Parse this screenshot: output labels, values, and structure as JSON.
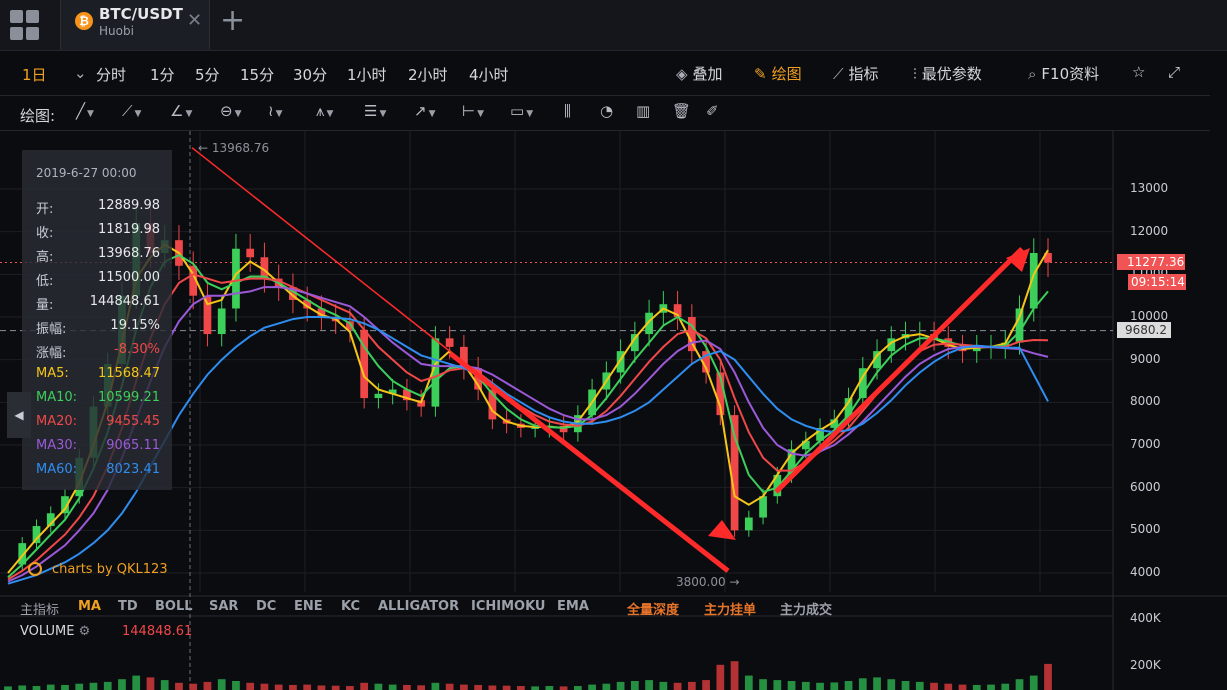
{
  "tab": {
    "title": "BTC/USDT",
    "exchange": "Huobi",
    "coin_glyph": "₿",
    "close_glyph": "✕",
    "add_glyph": "+"
  },
  "periods": [
    {
      "label": "1日",
      "active": true
    },
    {
      "label": "分时",
      "active": false
    },
    {
      "label": "1分",
      "active": false
    },
    {
      "label": "5分",
      "active": false
    },
    {
      "label": "15分",
      "active": false
    },
    {
      "label": "30分",
      "active": false
    },
    {
      "label": "1小时",
      "active": false
    },
    {
      "label": "2小时",
      "active": false
    },
    {
      "label": "4小时",
      "active": false
    }
  ],
  "toolbar_right": {
    "overlay": "叠加",
    "draw": "绘图",
    "indicator": "指标",
    "optimal": "最优参数",
    "f10": "F10资料"
  },
  "draw_bar": {
    "label": "绘图:"
  },
  "info_panel": {
    "date": "2019-6-27 00:00",
    "rows": [
      {
        "k": "开:",
        "v": "12889.98",
        "color": "#e6e8ec"
      },
      {
        "k": "收:",
        "v": "11819.98",
        "color": "#e6e8ec"
      },
      {
        "k": "高:",
        "v": "13968.76",
        "color": "#e6e8ec"
      },
      {
        "k": "低:",
        "v": "11500.00",
        "color": "#e6e8ec"
      },
      {
        "k": "量:",
        "v": "144848.61",
        "color": "#e6e8ec"
      },
      {
        "k": "振幅:",
        "v": "19.15%",
        "color": "#e6e8ec"
      },
      {
        "k": "涨幅:",
        "v": "-8.30%",
        "color": "#f04848"
      },
      {
        "k": "MA5:",
        "v": "11568.47",
        "color": "#f5c518"
      },
      {
        "k": "MA10:",
        "v": "10599.21",
        "color": "#3ccf5a"
      },
      {
        "k": "MA20:",
        "v": "9455.45",
        "color": "#f04848"
      },
      {
        "k": "MA30:",
        "v": "9065.11",
        "color": "#9b59d8"
      },
      {
        "k": "MA60:",
        "v": "8023.41",
        "color": "#2f8df0"
      }
    ]
  },
  "indicators": {
    "label": "主指标",
    "items": [
      "MA",
      "TD",
      "BOLL",
      "SAR",
      "DC",
      "ENE",
      "KC",
      "ALLIGATOR",
      "ICHIMOKU",
      "EMA"
    ],
    "active": "MA",
    "extras": [
      "全量深度",
      "主力挂单",
      "主力成交"
    ]
  },
  "volume": {
    "title": "VOLUME",
    "gear": "⚙",
    "value": "144848.61"
  },
  "brand": "charts by QKL123",
  "markers": {
    "high": "← 13968.76",
    "low": "3800.00 →",
    "price": "11277.36",
    "time": "09:15:14",
    "ref": "9680.2"
  },
  "chart_data": {
    "type": "line",
    "title": "",
    "y_ticks": [
      13000,
      12000,
      11000,
      10000,
      9000,
      8000,
      7000,
      6000,
      5000,
      4000
    ],
    "volume_ticks": [
      "400K",
      "200K"
    ],
    "ylim": [
      3500,
      14300
    ],
    "grid": true,
    "current_price": 11277.36,
    "reference_price": 9680.2,
    "high": 13968.76,
    "low": 3800.0,
    "close_series": [
      4200,
      4700,
      5100,
      5400,
      5800,
      6700,
      7900,
      8900,
      10500,
      12200,
      11500,
      11800,
      11200,
      10500,
      9600,
      10200,
      11600,
      11400,
      10900,
      10700,
      10400,
      10200,
      10000,
      9900,
      9700,
      8100,
      8200,
      8300,
      8050,
      7900,
      9500,
      9300,
      8800,
      8300,
      7600,
      7500,
      7400,
      7400,
      7450,
      7300,
      7700,
      8300,
      8700,
      9200,
      9600,
      10100,
      10300,
      10000,
      9200,
      8700,
      7700,
      5000,
      5300,
      5800,
      6300,
      6900,
      7100,
      7400,
      7600,
      8100,
      8800,
      9200,
      9500,
      9600,
      9600,
      9500,
      9300,
      9200,
      9300,
      9300,
      9400,
      10200,
      11500,
      11277
    ],
    "series": [
      {
        "name": "MA5",
        "color": "#f5c518",
        "values": [
          4000,
          4400,
          4800,
          5150,
          5500,
          6100,
          7000,
          8000,
          9400,
          10900,
          11400,
          11700,
          11500,
          11000,
          10300,
          10400,
          11000,
          11300,
          11100,
          10800,
          10500,
          10250,
          10050,
          9950,
          9650,
          8600,
          8300,
          8200,
          8100,
          8000,
          8900,
          9200,
          8900,
          8400,
          7800,
          7550,
          7450,
          7420,
          7430,
          7400,
          7550,
          8000,
          8500,
          9000,
          9500,
          9900,
          10200,
          10050,
          9400,
          8800,
          7900,
          5800,
          5600,
          5800,
          6300,
          6800,
          7100,
          7350,
          7550,
          8000,
          8600,
          9100,
          9400,
          9550,
          9600,
          9500,
          9350,
          9250,
          9280,
          9300,
          9380,
          10000,
          11000,
          11568
        ]
      },
      {
        "name": "MA10",
        "color": "#3ccf5a",
        "values": [
          3900,
          4200,
          4550,
          4900,
          5250,
          5750,
          6450,
          7300,
          8400,
          9700,
          10700,
          11300,
          11450,
          11250,
          10800,
          10650,
          10800,
          10950,
          10950,
          10800,
          10600,
          10400,
          10200,
          10050,
          9850,
          9300,
          8850,
          8500,
          8300,
          8150,
          8500,
          8800,
          8850,
          8600,
          8200,
          7850,
          7600,
          7450,
          7420,
          7400,
          7450,
          7700,
          8100,
          8550,
          9000,
          9400,
          9800,
          10000,
          9800,
          9300,
          8600,
          7200,
          6300,
          5900,
          6000,
          6400,
          6800,
          7100,
          7350,
          7700,
          8200,
          8700,
          9100,
          9350,
          9500,
          9500,
          9420,
          9330,
          9300,
          9300,
          9330,
          9650,
          10200,
          10599
        ]
      },
      {
        "name": "MA20",
        "color": "#f04848",
        "values": [
          3850,
          4050,
          4300,
          4600,
          4900,
          5300,
          5800,
          6500,
          7400,
          8500,
          9500,
          10300,
          10800,
          11000,
          10900,
          10800,
          10850,
          10900,
          10900,
          10850,
          10700,
          10550,
          10400,
          10250,
          10100,
          9700,
          9300,
          9000,
          8700,
          8500,
          8600,
          8750,
          8800,
          8700,
          8450,
          8150,
          7900,
          7700,
          7550,
          7480,
          7450,
          7550,
          7800,
          8150,
          8550,
          8950,
          9300,
          9600,
          9700,
          9500,
          9000,
          8100,
          7300,
          6700,
          6400,
          6400,
          6600,
          6850,
          7100,
          7400,
          7800,
          8200,
          8600,
          8950,
          9200,
          9350,
          9380,
          9350,
          9320,
          9300,
          9300,
          9420,
          9460,
          9455
        ]
      },
      {
        "name": "MA30",
        "color": "#9b59d8",
        "values": [
          3800,
          3950,
          4150,
          4400,
          4650,
          5000,
          5400,
          5950,
          6700,
          7600,
          8500,
          9300,
          9900,
          10300,
          10500,
          10500,
          10550,
          10600,
          10700,
          10700,
          10650,
          10550,
          10450,
          10350,
          10250,
          10000,
          9700,
          9400,
          9150,
          8900,
          8850,
          8850,
          8850,
          8800,
          8650,
          8450,
          8250,
          8050,
          7850,
          7700,
          7600,
          7600,
          7700,
          7900,
          8200,
          8550,
          8900,
          9200,
          9400,
          9450,
          9250,
          8700,
          8000,
          7400,
          7000,
          6800,
          6750,
          6850,
          7000,
          7250,
          7550,
          7900,
          8250,
          8600,
          8900,
          9100,
          9250,
          9300,
          9300,
          9290,
          9270,
          9250,
          9150,
          9065
        ]
      },
      {
        "name": "MA60",
        "color": "#2f8df0",
        "values": [
          3750,
          3850,
          3950,
          4100,
          4250,
          4450,
          4700,
          5000,
          5400,
          5900,
          6500,
          7100,
          7700,
          8200,
          8650,
          9000,
          9300,
          9550,
          9750,
          9850,
          9950,
          10000,
          10000,
          9980,
          9950,
          9850,
          9700,
          9500,
          9300,
          9100,
          9000,
          8900,
          8800,
          8650,
          8450,
          8200,
          8000,
          7800,
          7650,
          7550,
          7500,
          7500,
          7550,
          7650,
          7800,
          8000,
          8300,
          8600,
          8900,
          9100,
          9200,
          9000,
          8600,
          8200,
          7850,
          7600,
          7450,
          7350,
          7300,
          7350,
          7500,
          7750,
          8050,
          8400,
          8700,
          8950,
          9150,
          9280,
          9330,
          9300,
          9280,
          9280,
          8650,
          8023
        ]
      }
    ],
    "volume_values": [
      20,
      25,
      22,
      30,
      28,
      35,
      40,
      45,
      60,
      80,
      70,
      55,
      40,
      35,
      45,
      60,
      50,
      40,
      35,
      30,
      28,
      30,
      25,
      24,
      22,
      40,
      35,
      30,
      28,
      26,
      40,
      35,
      30,
      28,
      25,
      24,
      22,
      20,
      22,
      20,
      22,
      30,
      35,
      45,
      50,
      55,
      45,
      40,
      45,
      55,
      140,
      160,
      80,
      60,
      55,
      50,
      45,
      40,
      42,
      50,
      65,
      70,
      60,
      50,
      45,
      40,
      35,
      30,
      28,
      30,
      35,
      60,
      80,
      145
    ]
  }
}
